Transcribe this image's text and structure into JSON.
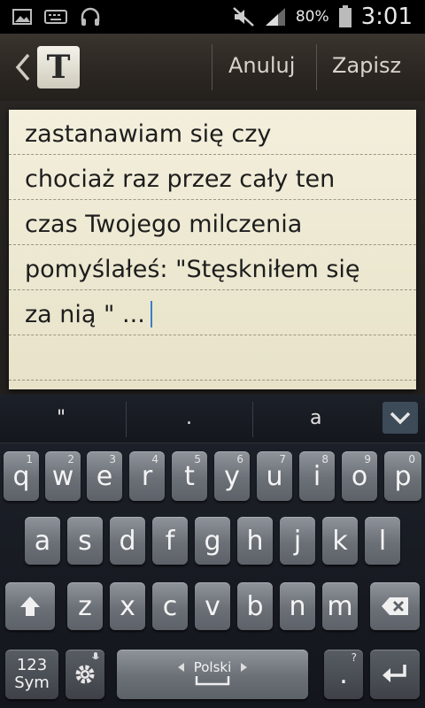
{
  "status_bar": {
    "battery": "80%",
    "time": "3:01"
  },
  "action_bar": {
    "app_icon_letter": "T",
    "cancel": "Anuluj",
    "save": "Zapisz"
  },
  "note": {
    "lines": [
      "zastanawiam się czy",
      "chociaż raz przez cały ten",
      "czas Twojego milczenia",
      "pomyślałeś: \"Stęskniłem się",
      "za nią \" ..."
    ]
  },
  "keyboard": {
    "suggestions": [
      "\"",
      ".",
      "a"
    ],
    "row1": [
      {
        "k": "q",
        "n": "1"
      },
      {
        "k": "w",
        "n": "2"
      },
      {
        "k": "e",
        "n": "3"
      },
      {
        "k": "r",
        "n": "4"
      },
      {
        "k": "t",
        "n": "5"
      },
      {
        "k": "y",
        "n": "6"
      },
      {
        "k": "u",
        "n": "7"
      },
      {
        "k": "i",
        "n": "8"
      },
      {
        "k": "o",
        "n": "9"
      },
      {
        "k": "p",
        "n": "0"
      }
    ],
    "row2": [
      "a",
      "s",
      "d",
      "f",
      "g",
      "h",
      "j",
      "k",
      "l"
    ],
    "row3": [
      "z",
      "x",
      "c",
      "v",
      "b",
      "n",
      "m"
    ],
    "sym_line1": "123",
    "sym_line2": "Sym",
    "space_language": "Polski",
    "dot_key": ".",
    "dot_hint": "?"
  }
}
